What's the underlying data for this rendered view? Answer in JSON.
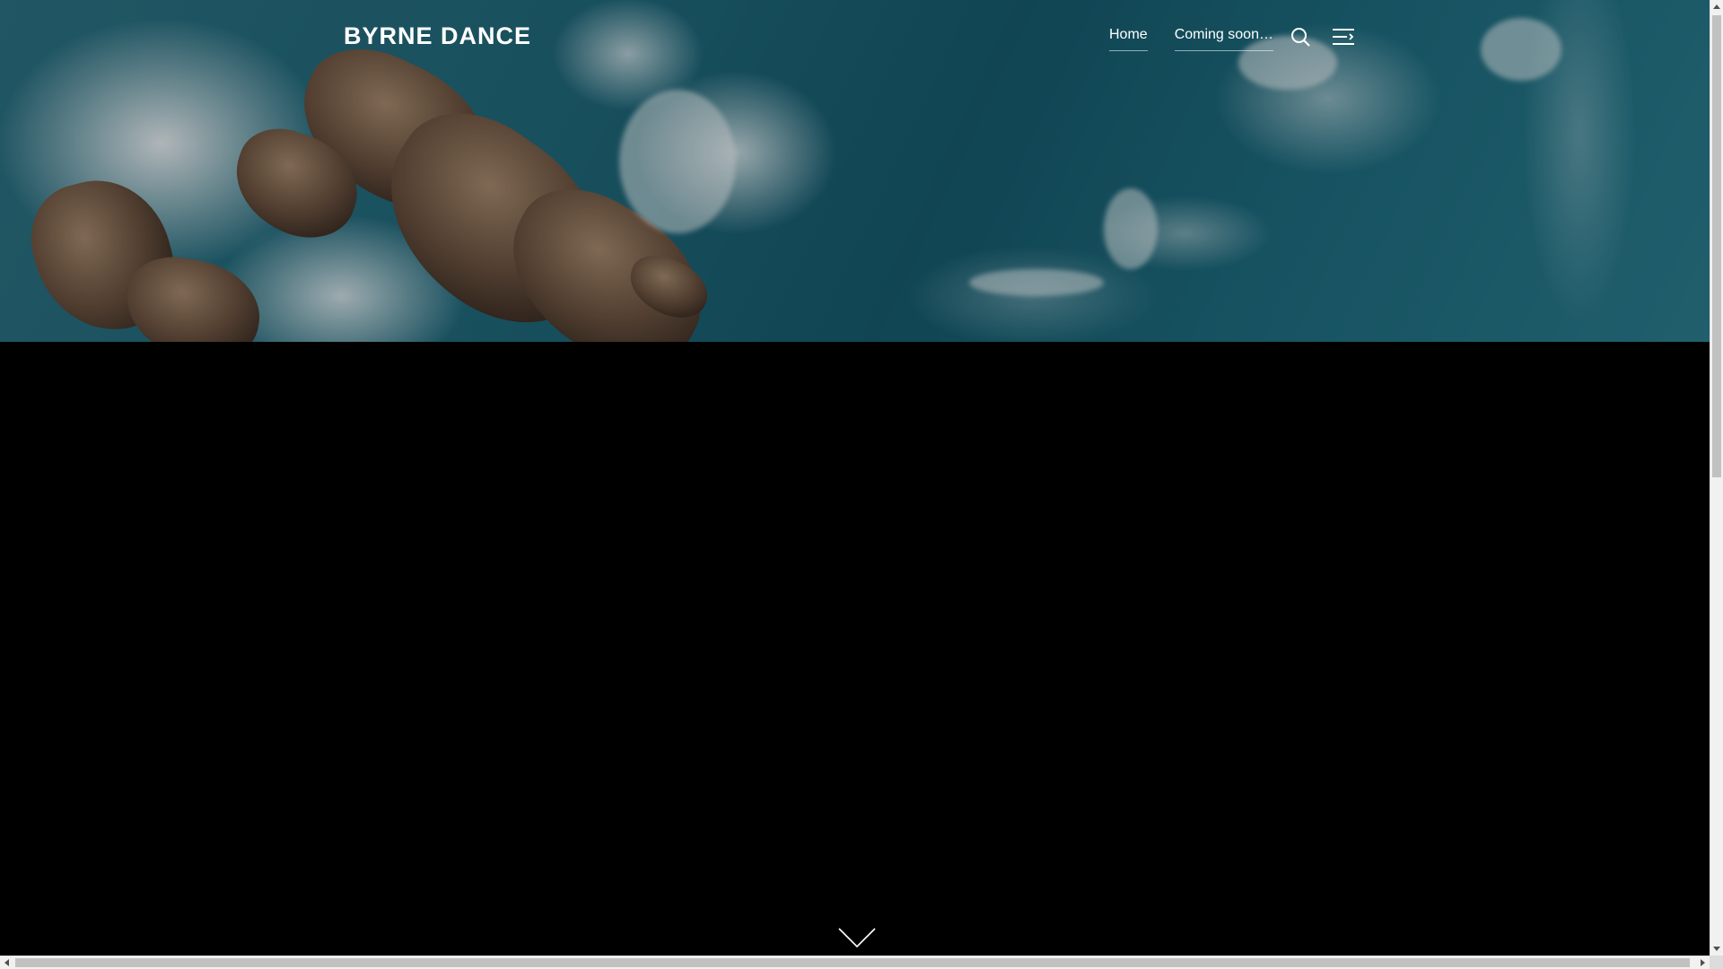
{
  "site": {
    "title": "BYRNE DANCE"
  },
  "nav": {
    "items": [
      {
        "label": "Home"
      },
      {
        "label": "Coming soon…"
      }
    ]
  },
  "icons": {
    "search": "search-icon",
    "menu": "menu-toggle-icon",
    "scroll": "chevron-down-icon"
  },
  "colors": {
    "text": "#ffffff",
    "background": "#000000",
    "ocean": "#1f6678"
  }
}
